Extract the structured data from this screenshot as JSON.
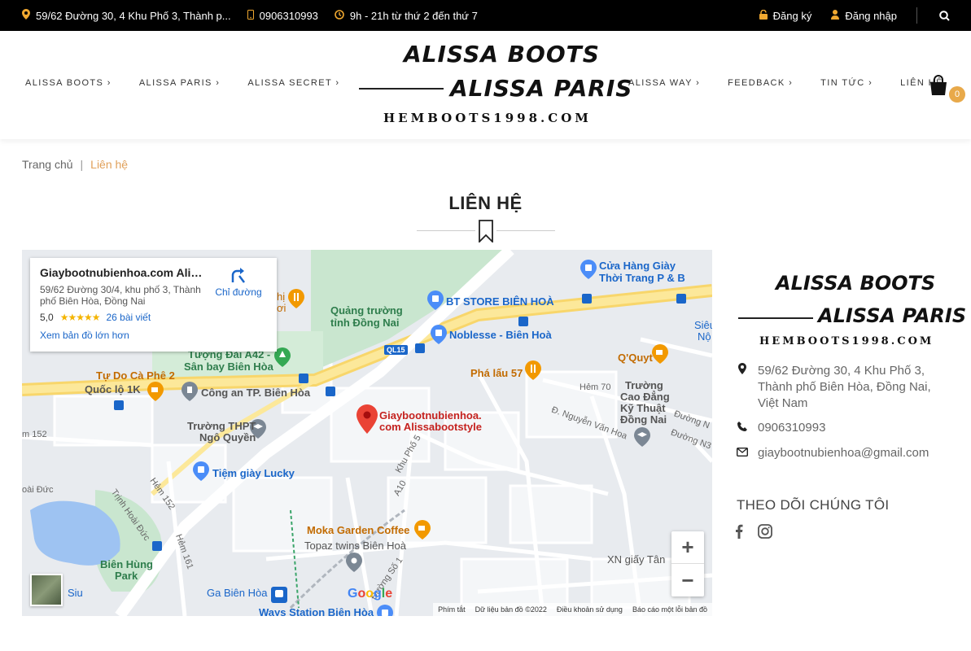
{
  "topbar": {
    "address": "59/62 Đường 30, 4 Khu Phố 3, Thành p...",
    "phone": "0906310993",
    "hours": "9h - 21h từ thứ 2 đến thứ 7",
    "register": "Đăng ký",
    "login": "Đăng nhập"
  },
  "nav": {
    "left": [
      "ALISSA BOOTS",
      "ALISSA PARIS",
      "ALISSA SECRET"
    ],
    "right": [
      "ALISSA WAY",
      "FEEDBACK",
      "TIN TỨC",
      "LIÊN HỆ"
    ]
  },
  "logo": {
    "line1": "ALISSA BOOTS",
    "line2": "ALISSA PARIS",
    "line3": "HEMBOOTS1998.COM"
  },
  "cart": {
    "count": "0"
  },
  "breadcrumb": {
    "home": "Trang chủ",
    "separator": "|",
    "current": "Liên hệ"
  },
  "page_title": "LIÊN HỆ",
  "map": {
    "card": {
      "name": "Giaybootnubienhoa.com Aliss...",
      "address": "59/62 Đường 30/4, khu phố 3, Thành phố Biên Hòa, Đồng Nai",
      "rating": "5,0",
      "stars": "★★★★★",
      "reviews": "26 bài viết",
      "larger_map": "Xem bản đồ lớn hơn",
      "directions": "Chỉ đường"
    },
    "labels": {
      "shop1": "Cửa Hàng Giày",
      "shop1b": "Thời Trang P & B",
      "bt_store": "BT STORE BIÊN HOÀ",
      "square1": "Quảng trường",
      "square2": "tỉnh Đồng Nai",
      "noblesse": "Noblesse - Biên Hoà",
      "monument1": "Tượng Đài A42 -",
      "monument2": "Sân bay Biên Hòa",
      "cafe_tudo": "Tự Do Cà Phê 2",
      "ql1k": "Quốc lộ 1K",
      "police": "Công an TP. Biên Hòa",
      "hs1": "Trường THPT",
      "hs2": "Ngô Quyền",
      "shoe_lucky": "Tiệm giày Lucky",
      "pin1": "Giaybootnubienhoa.",
      "pin2": "com Alissabootstyle",
      "phalau": "Phá lấu 57",
      "qquyt": "Q'Quyt",
      "college1": "Trường",
      "college2": "Cao Đẳng",
      "college3": "Kỹ Thuật",
      "college4": "Đồng Nai",
      "moka": "Moka Garden Coffee",
      "topaz": "Topaz twins Biên Hoà",
      "park1": "Biên Hùng",
      "park2": "Park",
      "station": "Ga Biên Hòa",
      "ways": "Ways Station Biên Hòa",
      "xn": "XN giấy Tân",
      "ql15": "QL15",
      "hem70": "Hẻm 70",
      "hem152a": "Hẻm 152",
      "hem152b": "m 152",
      "hem161": "Hẻm 161",
      "trinh": "Trịnh Hoài Đức",
      "khupho5": "Khu Phố 5",
      "a10": "A10",
      "nguyenvanhoa": "Đ. Nguyễn Văn Hoa",
      "duongso1": "Đường Số 1",
      "hoiduc": "oài Đức",
      "siu": "Siu",
      "sieu1": "Siêu",
      "sieu2": "Nộ",
      "phi": "hị",
      "oi": "ơi",
      "dvn": "Đường N",
      "dvn2": "Đường N3"
    },
    "google": "Google",
    "attribution": [
      "Phím tắt",
      "Dữ liệu bản đồ ©2022",
      "Điều khoản sử dụng",
      "Báo cáo một lỗi bản đồ"
    ]
  },
  "contact": {
    "address": "59/62 Đường 30, 4 Khu Phố 3, Thành phố Biên Hòa, Đồng Nai, Việt Nam",
    "phone": "0906310993",
    "email": "giaybootnubienhoa@gmail.com",
    "follow": "THEO DÕI CHÚNG TÔI"
  },
  "colors": {
    "accent": "#e8a94a",
    "topbar": "#000000",
    "link": "#1a66c9"
  }
}
